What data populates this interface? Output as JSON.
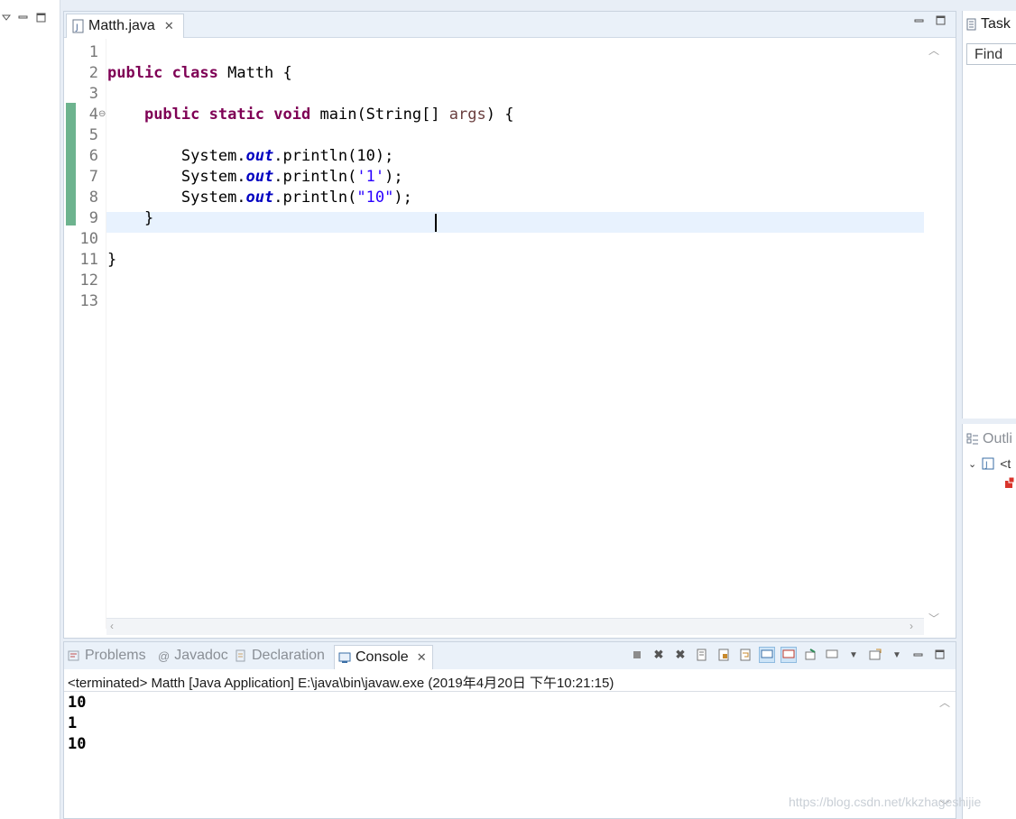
{
  "editor": {
    "tab_title": "Matth.java",
    "line_numbers": [
      "1",
      "2",
      "3",
      "4",
      "5",
      "6",
      "7",
      "8",
      "9",
      "10",
      "11",
      "12",
      "13"
    ],
    "code": {
      "line2": {
        "kw1": "public",
        "kw2": "class",
        "name": "Matth {"
      },
      "line4": {
        "kw1": "public",
        "kw2": "static",
        "kw3": "void",
        "sig": "main(String[] ",
        "param": "args",
        "end": ") {"
      },
      "line6": {
        "pre": "System.",
        "field": "out",
        "post": ".println(10);"
      },
      "line7": {
        "pre": "System.",
        "field": "out",
        "post": ".println(",
        "str": "'1'",
        "end": ");"
      },
      "line8": {
        "pre": "System.",
        "field": "out",
        "post": ".println(",
        "str": "\"10\"",
        "end": ");"
      },
      "line9": "}",
      "line11": "}"
    }
  },
  "console": {
    "tabs": {
      "problems": "Problems",
      "javadoc": "Javadoc",
      "declaration": "Declaration",
      "console": "Console"
    },
    "header": "<terminated> Matth [Java Application] E:\\java\\bin\\javaw.exe (2019年4月20日 下午10:21:15)",
    "output": [
      "10",
      "1",
      "10"
    ]
  },
  "right": {
    "task_tab": "Task",
    "find_placeholder": "Find",
    "outline_tab": "Outli",
    "outline_item": "<t"
  },
  "watermark": "https://blog.csdn.net/kkzhageshijie",
  "colors": {
    "keyword": "#7f0055",
    "field": "#0000c0",
    "string": "#2a00ff",
    "param": "#6a3e3e",
    "current_line": "#e8f2fe",
    "change_bar": "#6db38e"
  }
}
